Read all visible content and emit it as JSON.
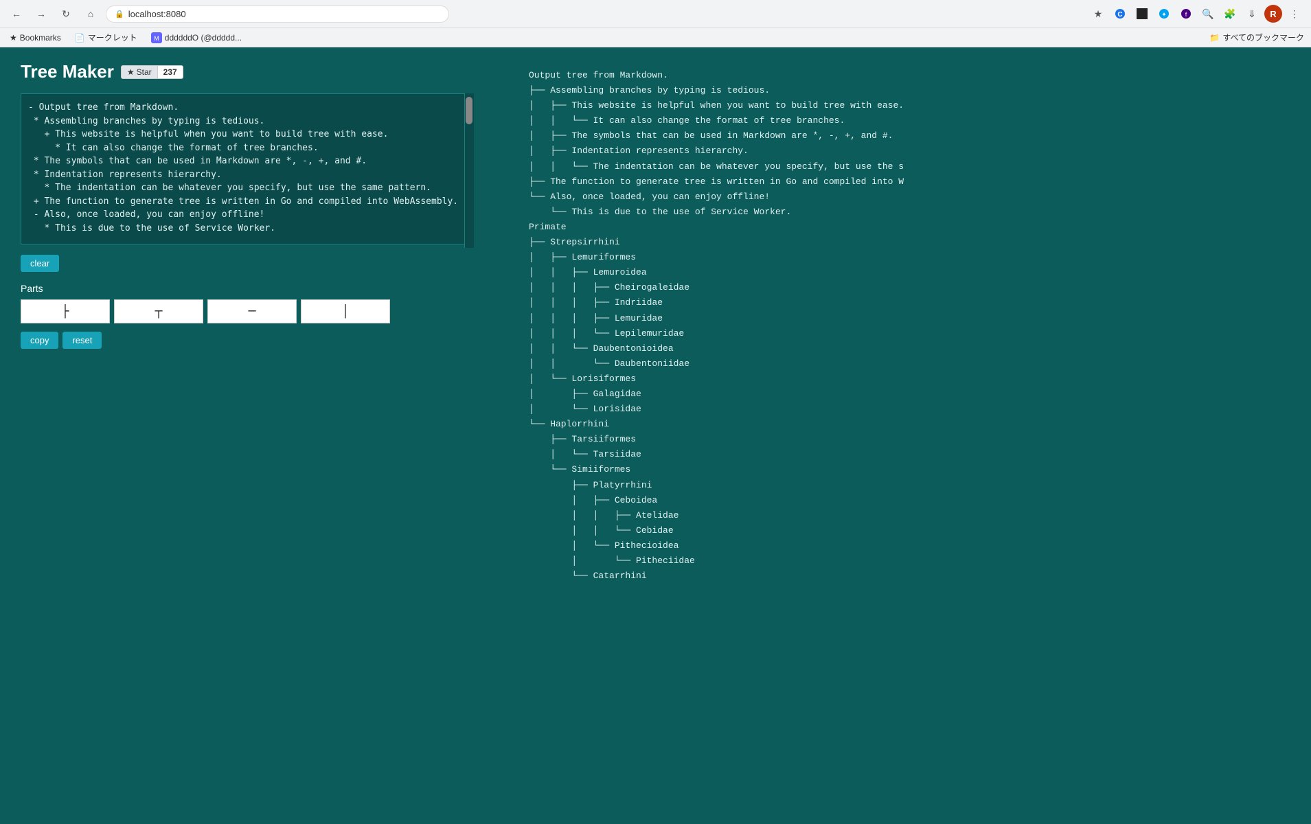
{
  "browser": {
    "url": "localhost:8080",
    "bookmarks": [
      {
        "label": "Bookmarks",
        "icon": "★"
      },
      {
        "label": "マークレット"
      },
      {
        "label": "ddddddO (@ddddd..."
      }
    ],
    "bookmarks_right": "すべてのブックマーク",
    "profile_letter": "R"
  },
  "app": {
    "title": "Tree Maker",
    "star_label": "Star",
    "star_count": "237",
    "textarea_content": "- Output tree from Markdown.\n * Assembling branches by typing is tedious.\n   + This website is helpful when you want to build tree with ease.\n     * It can also change the format of tree branches.\n * The symbols that can be used in Markdown are *, -, +, and #.\n * Indentation represents hierarchy.\n   * The indentation can be whatever you specify, but use the same pattern.\n + The function to generate tree is written in Go and compiled into WebAssembly.\n - Also, once loaded, you can enjoy offline!\n   * This is due to the use of Service Worker.",
    "clear_label": "clear",
    "parts_label": "Parts",
    "part_inputs": [
      "├",
      "┬",
      "─",
      "│"
    ],
    "copy_label": "copy",
    "reset_label": "reset"
  },
  "tree_output": {
    "lines": [
      "Output tree from Markdown.",
      "├── Assembling branches by typing is tedious.",
      "│   ├── This website is helpful when you want to build tree with ease.",
      "│   │   └── It can also change the format of tree branches.",
      "│   ├── The symbols that can be used in Markdown are *, -, +, and #.",
      "│   ├── Indentation represents hierarchy.",
      "│   │   └── The indentation can be whatever you specify, but use the s",
      "├── The function to generate tree is written in Go and compiled into W",
      "└── Also, once loaded, you can enjoy offline!",
      "    └── This is due to the use of Service Worker.",
      "Primate",
      "├── Strepsirrhini",
      "│   ├── Lemuriformes",
      "│   │   ├── Lemuroidea",
      "│   │   │   ├── Cheirogaleidae",
      "│   │   │   ├── Indriidae",
      "│   │   │   ├── Lemuridae",
      "│   │   │   └── Lepilemuridae",
      "│   │   └── Daubentonioidea",
      "│   │       └── Daubentoniidae",
      "│   └── Lorisiformes",
      "│       ├── Galagidae",
      "│       └── Lorisidae",
      "└── Haplorrhini",
      "    ├── Tarsiiformes",
      "    │   └── Tarsiidae",
      "    └── Simiiformes",
      "        ├── Platyrrhini",
      "        │   ├── Ceboidea",
      "        │   │   ├── Atelidae",
      "        │   │   └── Cebidae",
      "        │   └── Pithecioidea",
      "        │       └── Pitheciidae",
      "        └── Catarrhini"
    ]
  }
}
